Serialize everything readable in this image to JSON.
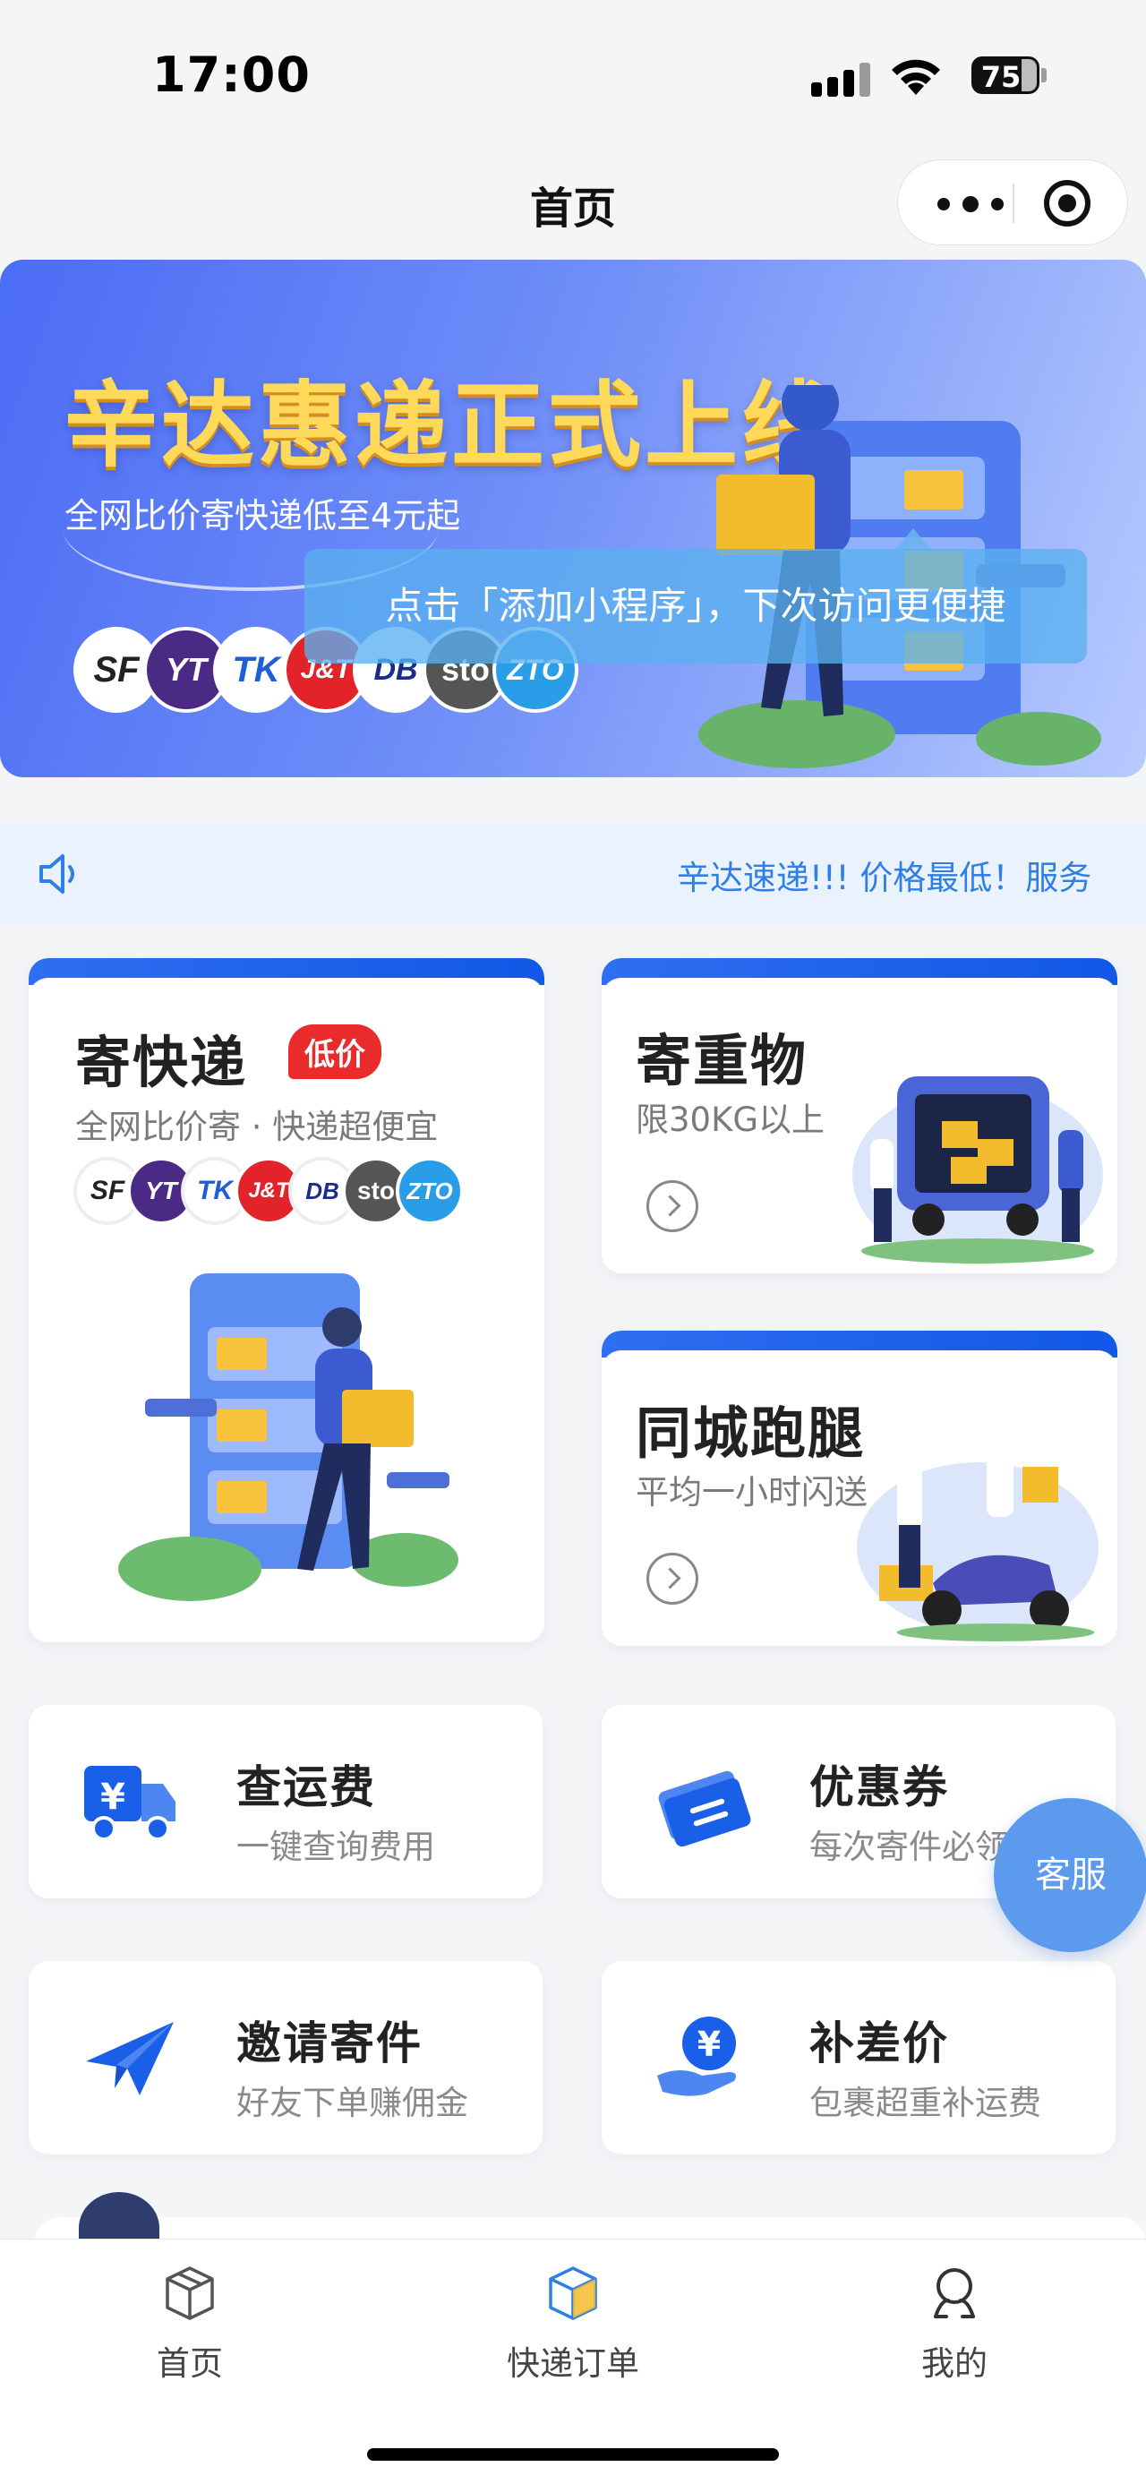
{
  "status_bar": {
    "time": "17:00",
    "battery": "75"
  },
  "nav": {
    "title": "首页"
  },
  "banner": {
    "headline": "辛达惠递正式上线",
    "subtitle": "全网比价寄快递低至4元起",
    "tip": "点击「添加小程序」，下次访问更便捷",
    "carriers": [
      "SF",
      "YT",
      "TK",
      "J&T",
      "DB",
      "sto",
      "ZTO"
    ]
  },
  "notice": {
    "text": "辛达速递!!! 价格最低！服务"
  },
  "services": {
    "express": {
      "title": "寄快递",
      "tag": "低价",
      "subtitle": "全网比价寄 · 快递超便宜"
    },
    "heavy": {
      "title": "寄重物",
      "subtitle": "限30KG以上"
    },
    "errand": {
      "title": "同城跑腿",
      "subtitle": "平均一小时闪送"
    }
  },
  "tools": [
    {
      "title": "查运费",
      "subtitle": "一键查询费用",
      "icon": "truck-yen-icon"
    },
    {
      "title": "优惠券",
      "subtitle": "每次寄件必领",
      "icon": "coupon-icon"
    },
    {
      "title": "邀请寄件",
      "subtitle": "好友下单赚佣金",
      "icon": "paper-plane-icon"
    },
    {
      "title": "补差价",
      "subtitle": "包裹超重补运费",
      "icon": "hand-yen-icon"
    }
  ],
  "float_button": "客服",
  "tabbar": [
    {
      "label": "首页",
      "icon": "box-icon"
    },
    {
      "label": "快递订单",
      "icon": "cube-icon"
    },
    {
      "label": "我的",
      "icon": "user-icon"
    }
  ],
  "colors": {
    "primary": "#1a5fe8",
    "accent_red": "#ea2b2b",
    "notice_text": "#2f7fe6",
    "float": "#5c9aee"
  }
}
